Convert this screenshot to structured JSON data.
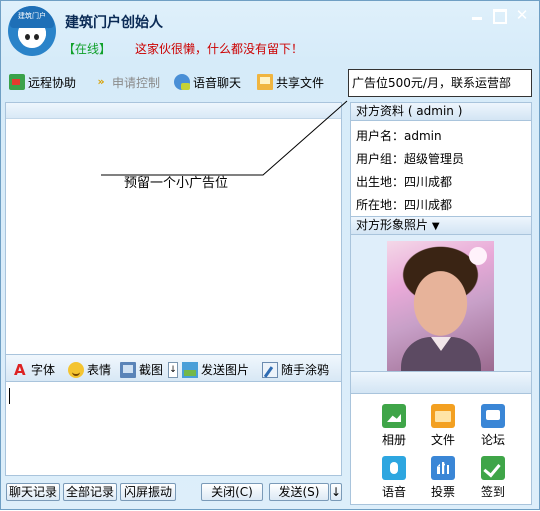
{
  "window": {
    "title": "建筑门户创始人",
    "status": "【在线】",
    "signature": "这家伙很懒，什么都没有留下！",
    "avatar_text": "建筑门户",
    "controls": {
      "minimize_icon": "minimize-icon",
      "maximize_icon": "maximize-icon",
      "close_label": "✕"
    }
  },
  "toolbar": {
    "remote_assist": "远程协助",
    "request_control": "申请控制",
    "voice_chat": "语音聊天",
    "share_files": "共享文件",
    "request_control_arrow": "»"
  },
  "ad_banner": "广告位500元/月，联系运营部",
  "chat": {
    "ad_note": "预留一个小广告位"
  },
  "format_bar": {
    "font_glyph": "A",
    "font": "字体",
    "emoji": "表情",
    "screenshot": "截图",
    "screenshot_arrow": "↓",
    "send_picture": "发送图片",
    "doodle": "随手涂鸦"
  },
  "bottom_buttons": {
    "chat_log": "聊天记录",
    "all_log": "全部记录",
    "shake": "闪屏振动",
    "close": "关闭(C)",
    "send": "发送(S)",
    "send_arrow": "↓"
  },
  "profile": {
    "header": "对方资料 ( admin )",
    "rows": [
      "用户名：admin",
      "用户组：超级管理员",
      "出生地：四川成都",
      "所在地：四川成都"
    ],
    "photo_header": "对方形象照片",
    "photo_header_arrow": "▼"
  },
  "apps": [
    {
      "label": "相册",
      "icon": "album-icon"
    },
    {
      "label": "文件",
      "icon": "folder-icon"
    },
    {
      "label": "论坛",
      "icon": "forum-icon"
    },
    {
      "label": "语音",
      "icon": "voice-icon"
    },
    {
      "label": "投票",
      "icon": "vote-icon"
    },
    {
      "label": "签到",
      "icon": "sign-in-icon"
    }
  ],
  "colors": {
    "status_green": "#10a02a",
    "signature_red": "#cc0000",
    "window_bg": "#d6ebf9",
    "border_blue": "#a9c4dc"
  }
}
